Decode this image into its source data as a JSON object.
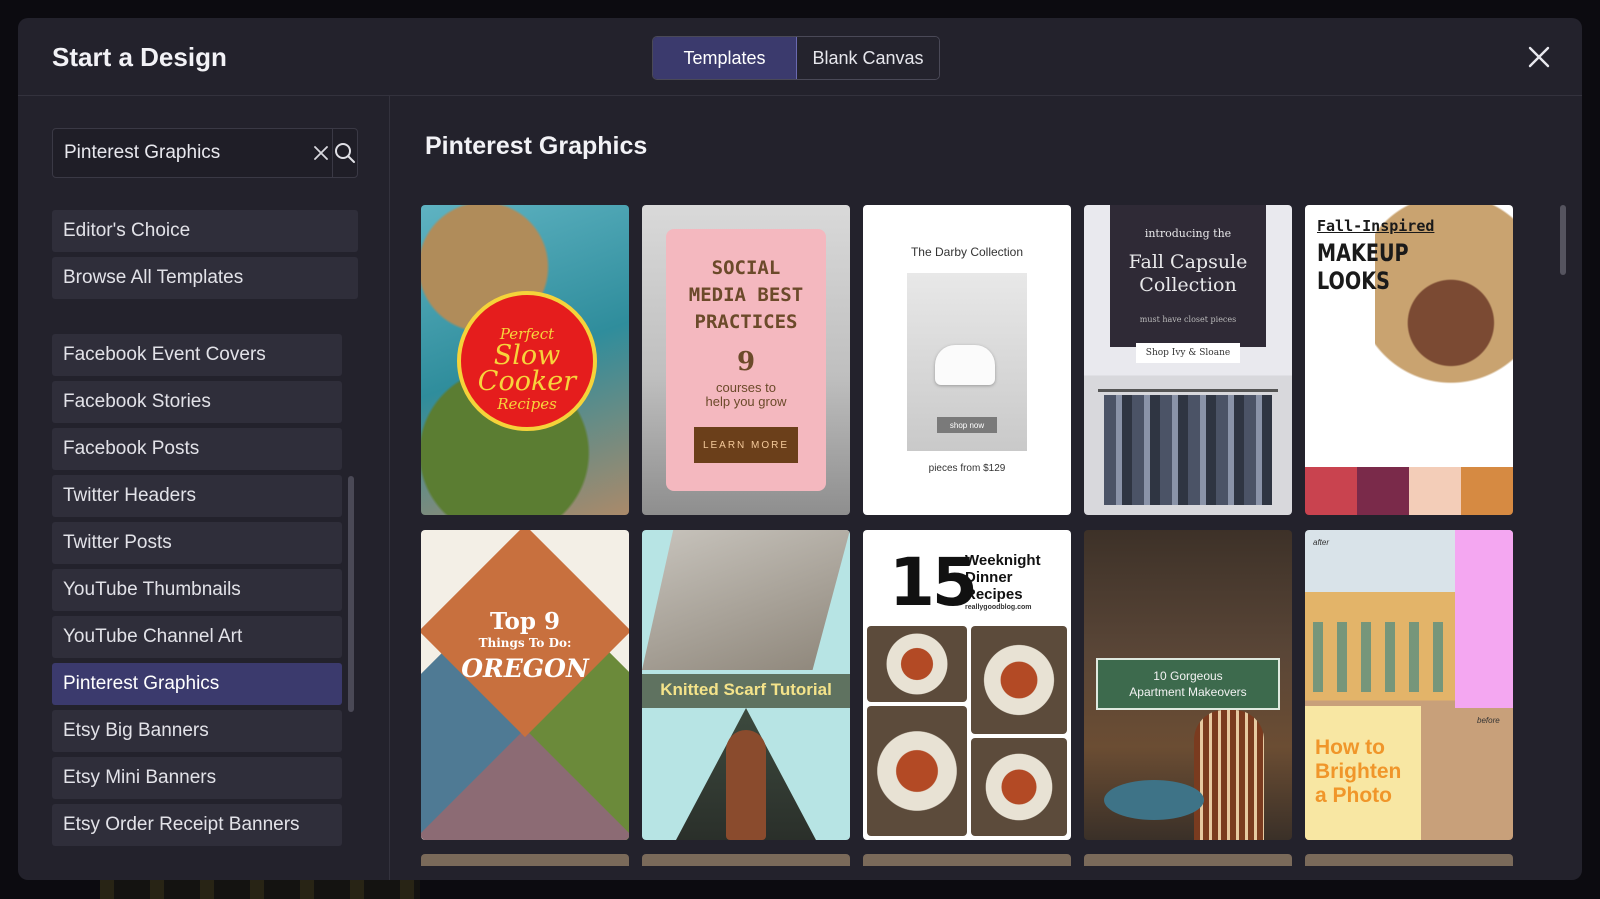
{
  "modal": {
    "title": "Start a Design",
    "tabs": [
      {
        "label": "Templates",
        "active": true
      },
      {
        "label": "Blank Canvas",
        "active": false
      }
    ]
  },
  "sidebar": {
    "search": {
      "value": "Pinterest Graphics",
      "placeholder": ""
    },
    "top_items": [
      {
        "label": "Editor's Choice"
      },
      {
        "label": "Browse All Templates"
      }
    ],
    "categories": [
      {
        "label": "Facebook Event Covers"
      },
      {
        "label": "Facebook Stories"
      },
      {
        "label": "Facebook Posts"
      },
      {
        "label": "Twitter Headers"
      },
      {
        "label": "Twitter Posts"
      },
      {
        "label": "YouTube Thumbnails"
      },
      {
        "label": "YouTube Channel Art"
      },
      {
        "label": "Pinterest Graphics",
        "active": true
      },
      {
        "label": "Etsy Big Banners"
      },
      {
        "label": "Etsy Mini Banners"
      },
      {
        "label": "Etsy Order Receipt Banners"
      }
    ]
  },
  "main": {
    "section_title": "Pinterest Graphics",
    "templates": [
      {
        "line1": "Perfect",
        "line2": "Slow",
        "line3": "Cooker",
        "line4": "Recipes"
      },
      {
        "line1": "SOCIAL",
        "line2": "MEDIA BEST",
        "line3": "PRACTICES",
        "number": "9",
        "sub1": "courses to",
        "sub2": "help you grow",
        "button": "LEARN MORE"
      },
      {
        "title": "The Darby Collection",
        "button": "shop now",
        "footer": "pieces from $129"
      },
      {
        "intro": "introducing the",
        "line1": "Fall Capsule",
        "line2": "Collection",
        "sub": "must have closet pieces",
        "button": "Shop Ivy & Sloane"
      },
      {
        "line1": "Fall-Inspired",
        "line2": "MAKEUP",
        "line3": "LOOKS",
        "swatches": [
          "#c9434f",
          "#7a2a4a",
          "#f3cdb8",
          "#d68a42"
        ]
      },
      {
        "line1": "Top 9",
        "line2": "Things To Do:",
        "line3": "OREGON"
      },
      {
        "title": "Knitted Scarf Tutorial"
      },
      {
        "number": "15",
        "line1": "Weeknight",
        "line2": "Dinner",
        "line3": "Recipes",
        "url": "reallygoodblog.com"
      },
      {
        "line1": "10 Gorgeous",
        "line2": "Apartment Makeovers"
      },
      {
        "tag_after": "after",
        "tag_before": "before",
        "line1": "How to",
        "line2": "Brighten",
        "line3": "a Photo"
      }
    ]
  },
  "icons": {
    "close": "close-icon",
    "search_clear": "clear-icon",
    "search": "search-icon"
  },
  "colors": {
    "modal_bg": "#23222c",
    "active_accent": "#3b3a6d",
    "item_bg": "#2f2e3a"
  }
}
